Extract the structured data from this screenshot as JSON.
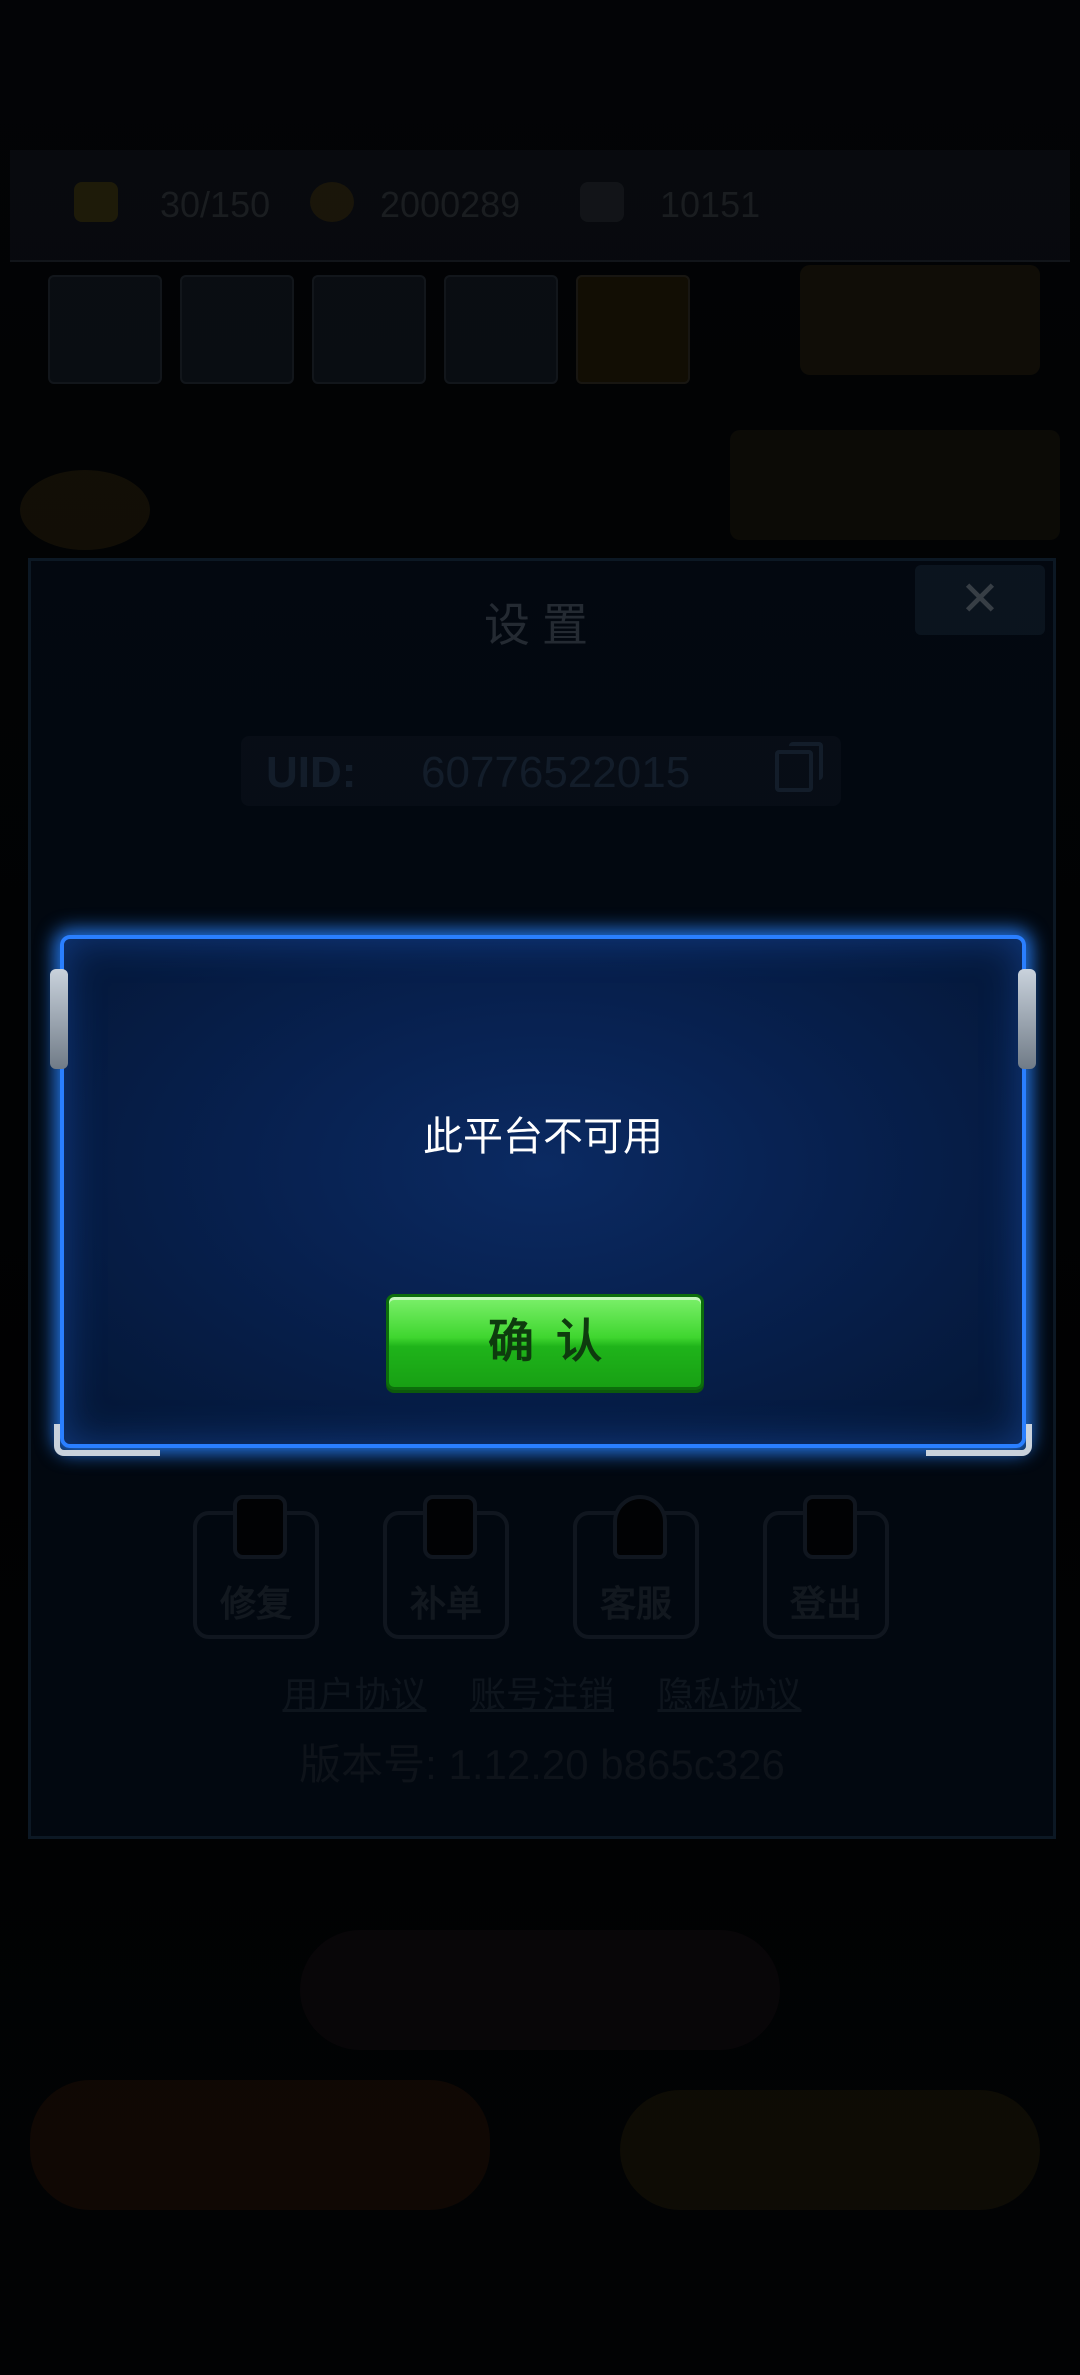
{
  "background": {
    "resources": [
      "30/150",
      "2000289",
      "10151"
    ],
    "settings_dialog": {
      "title": "设置",
      "close_symbol": "✕",
      "uid_label": "UID:",
      "uid_value": "60776522015",
      "buttons": [
        {
          "label": "修复",
          "icon": "wrench-icon"
        },
        {
          "label": "补单",
          "icon": "order-icon"
        },
        {
          "label": "客服",
          "icon": "headset-icon"
        },
        {
          "label": "登出",
          "icon": "logout-icon"
        }
      ],
      "links": [
        "用户协议",
        "账号注销",
        "隐私协议"
      ],
      "version": "版本号: 1.12.20 b865c326"
    }
  },
  "popup": {
    "message": "此平台不可用",
    "confirm_label": "确认"
  },
  "colors": {
    "popup_border": "#2a7fff",
    "popup_fill": "#07204e",
    "confirm_green": "#3fd62f"
  }
}
